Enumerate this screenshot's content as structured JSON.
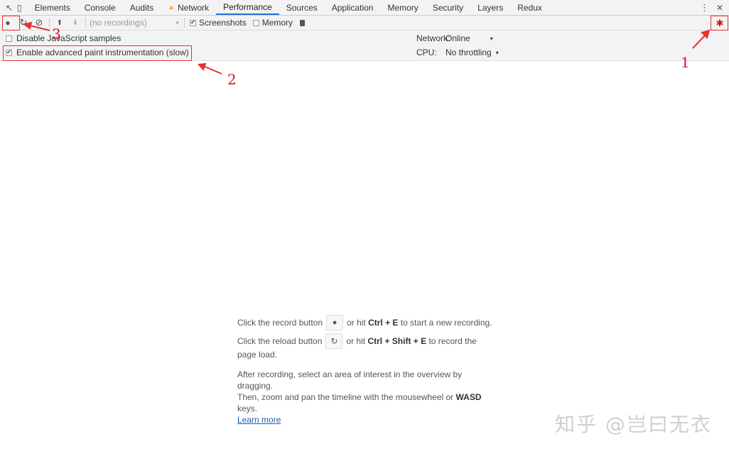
{
  "tabs": [
    {
      "label": "Elements"
    },
    {
      "label": "Console"
    },
    {
      "label": "Audits"
    },
    {
      "label": "Network",
      "warning": true
    },
    {
      "label": "Performance",
      "active": true
    },
    {
      "label": "Sources"
    },
    {
      "label": "Application"
    },
    {
      "label": "Memory"
    },
    {
      "label": "Security"
    },
    {
      "label": "Layers"
    },
    {
      "label": "Redux"
    }
  ],
  "icons": {
    "inspect": "↖",
    "device": "▯",
    "more": "⋮",
    "close": "✕",
    "record": "●",
    "reload": "↻",
    "clear": "⊘",
    "upload": "⬆",
    "download": "⬇",
    "trash": "🗑",
    "gear": "✱",
    "warning": "▲",
    "dropdown": "▾"
  },
  "toolbar": {
    "recordings_select": "(no recordings)",
    "screenshots_label": "Screenshots",
    "screenshots_checked": true,
    "memory_label": "Memory",
    "memory_checked": false
  },
  "settings": {
    "disable_js_samples": "Disable JavaScript samples",
    "disable_js_checked": false,
    "advanced_paint": "Enable advanced paint instrumentation (slow)",
    "advanced_paint_checked": true,
    "network_label": "Network:",
    "network_value": "Online",
    "cpu_label": "CPU:",
    "cpu_value": "No throttling"
  },
  "landing": {
    "record_pre": "Click the record button",
    "record_post_1": "or hit",
    "record_key": "Ctrl + E",
    "record_post_2": "to start a new recording.",
    "reload_pre": "Click the reload button",
    "reload_post_1": "or hit",
    "reload_key": "Ctrl + Shift + E",
    "reload_post_2": "to record the",
    "reload_post_3": "page load.",
    "after_1": "After recording, select an area of interest in the overview by",
    "after_2": "dragging.",
    "zoom_1": "Then, zoom and pan the timeline with the mousewheel or",
    "zoom_key": "WASD",
    "zoom_2": "keys.",
    "learn_more": "Learn more"
  },
  "annotations": {
    "n1": "1",
    "n2": "2",
    "n3": "3",
    "color": "#e53333"
  },
  "watermark": "知乎 @岂曰无衣",
  "colors": {
    "active_tab": "#1a73e8",
    "gear": "#dd1111",
    "link": "#1a5fb4"
  }
}
